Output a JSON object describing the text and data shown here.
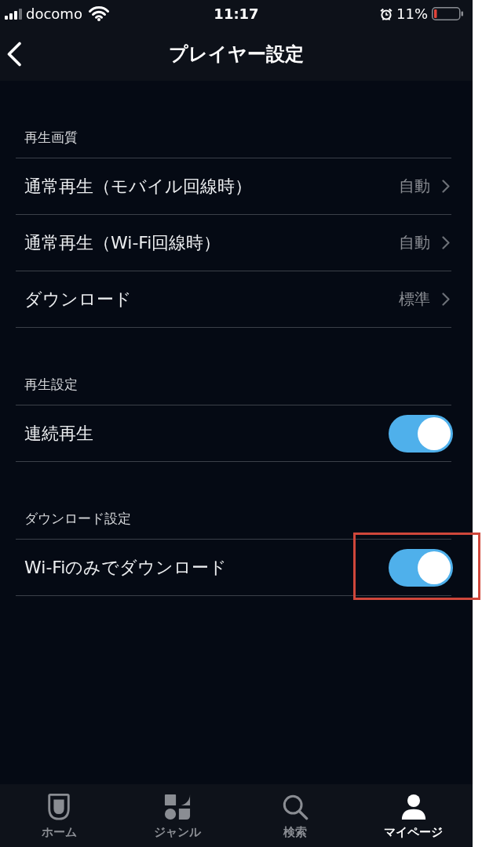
{
  "status_bar": {
    "carrier": "docomo",
    "time": "11:17",
    "battery": "11%"
  },
  "nav": {
    "title": "プレイヤー設定"
  },
  "sections": [
    {
      "title": "再生画質",
      "rows": [
        {
          "kind": "link",
          "label": "通常再生（モバイル回線時）",
          "value": "自動",
          "highlighted": false
        },
        {
          "kind": "link",
          "label": "通常再生（Wi-Fi回線時）",
          "value": "自動",
          "highlighted": false
        },
        {
          "kind": "link",
          "label": "ダウンロード",
          "value": "標準",
          "highlighted": false
        }
      ]
    },
    {
      "title": "再生設定",
      "rows": [
        {
          "kind": "toggle",
          "label": "連続再生",
          "on": true,
          "highlighted": false
        }
      ]
    },
    {
      "title": "ダウンロード設定",
      "rows": [
        {
          "kind": "toggle",
          "label": "Wi-Fiのみでダウンロード",
          "on": true,
          "highlighted": true
        }
      ]
    }
  ],
  "tab_bar": [
    {
      "kind": "home",
      "label": "ホーム",
      "selected": false
    },
    {
      "kind": "genre",
      "label": "ジャンル",
      "selected": false
    },
    {
      "kind": "search",
      "label": "検索",
      "selected": false
    },
    {
      "kind": "mypage",
      "label": "マイページ",
      "selected": true
    }
  ]
}
